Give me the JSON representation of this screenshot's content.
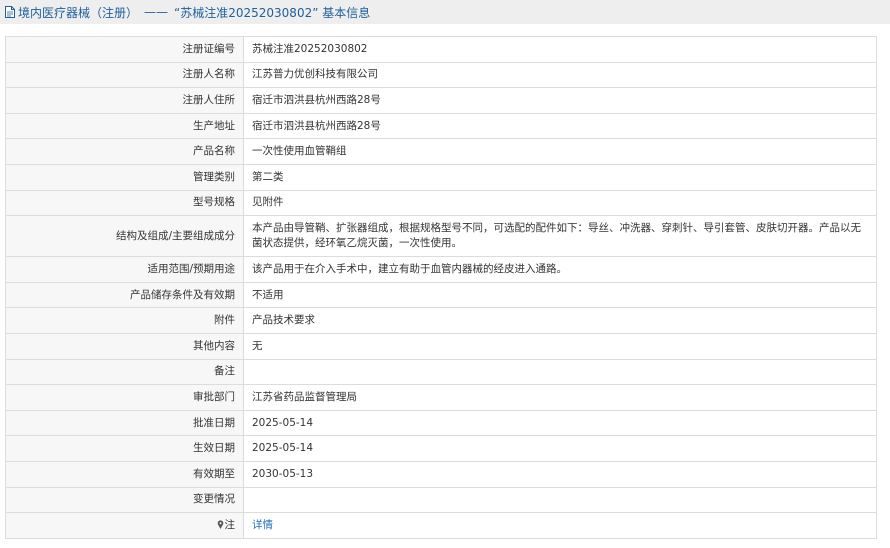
{
  "header": {
    "category": "境内医疗器械（注册）",
    "separator": "——",
    "title": "“苏械注准20252030802” 基本信息"
  },
  "rows": [
    {
      "label": "注册证编号",
      "value": "苏械注准20252030802"
    },
    {
      "label": "注册人名称",
      "value": "江苏普力优创科技有限公司"
    },
    {
      "label": "注册人住所",
      "value": "宿迁市泗洪县杭州西路28号"
    },
    {
      "label": "生产地址",
      "value": "宿迁市泗洪县杭州西路28号"
    },
    {
      "label": "产品名称",
      "value": "一次性使用血管鞘组"
    },
    {
      "label": "管理类别",
      "value": "第二类"
    },
    {
      "label": "型号规格",
      "value": "见附件"
    },
    {
      "label": "结构及组成/主要组成成分",
      "value": "本产品由导管鞘、扩张器组成，根据规格型号不同，可选配的配件如下：导丝、冲洗器、穿刺针、导引套管、皮肤切开器。产品以无菌状态提供，经环氧乙烷灭菌，一次性使用。"
    },
    {
      "label": "适用范围/预期用途",
      "value": "该产品用于在介入手术中，建立有助于血管内器械的经皮进入通路。"
    },
    {
      "label": "产品储存条件及有效期",
      "value": "不适用"
    },
    {
      "label": "附件",
      "value": "产品技术要求"
    },
    {
      "label": "其他内容",
      "value": "无"
    },
    {
      "label": "备注",
      "value": ""
    },
    {
      "label": "审批部门",
      "value": "江苏省药品监督管理局"
    },
    {
      "label": "批准日期",
      "value": "2025-05-14"
    },
    {
      "label": "生效日期",
      "value": "2025-05-14"
    },
    {
      "label": "有效期至",
      "value": "2030-05-13"
    },
    {
      "label": "变更情况",
      "value": ""
    },
    {
      "label": "注",
      "value": "详情"
    }
  ],
  "icons": {
    "header": "document-icon",
    "note": "pin-icon"
  },
  "colors": {
    "header_text": "#1f5f9b",
    "link": "#1f6fc5",
    "label_bg": "#f7f7f7",
    "border": "#dcdcdc"
  }
}
